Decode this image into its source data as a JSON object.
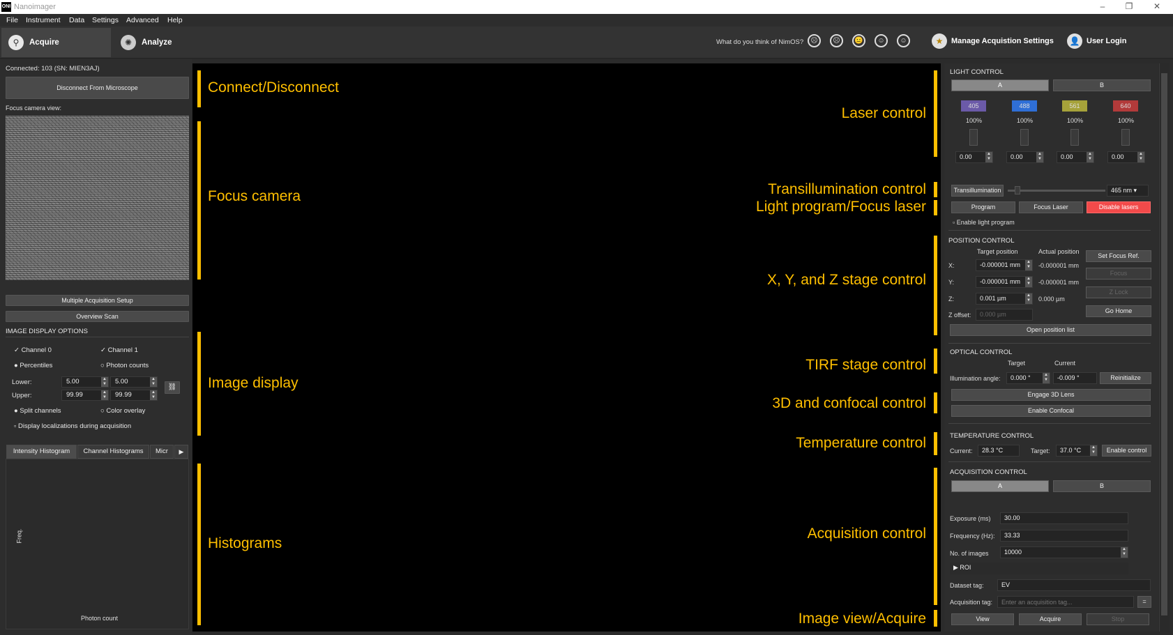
{
  "window": {
    "logo": "ONI",
    "title": "Nanoimager",
    "minimize": "–",
    "restore": "❐",
    "close": "✕"
  },
  "menu": [
    "File",
    "Instrument",
    "Data",
    "Settings",
    "Advanced",
    "Help"
  ],
  "topbar": {
    "acquire_tab": "Acquire",
    "analyze_tab": "Analyze",
    "feedback_prompt": "What do you think of NimOS?",
    "faces": [
      "☹",
      "☹",
      "😐",
      "☺",
      "☺"
    ],
    "manage_settings": "Manage Acquistion Settings",
    "user_login": "User Login"
  },
  "left": {
    "connected": "Connected: 103 (SN: MIEN3AJ)",
    "disconnect_button": "Disconnect From Microscope",
    "focus_camera_label": "Focus camera view:",
    "multi_acq_button": "Multiple Acquisition Setup",
    "overview_scan_button": "Overview Scan",
    "display_options_head": "IMAGE DISPLAY OPTIONS",
    "channel0": "Channel 0",
    "channel1": "Channel 1",
    "percentiles": "Percentiles",
    "photon_counts": "Photon counts",
    "lower_label": "Lower:",
    "upper_label": "Upper:",
    "lower0": "5.00",
    "lower1": "5.00",
    "upper0": "99.99",
    "upper1": "99.99",
    "split_channels": "Split channels",
    "color_overlay": "Color overlay",
    "display_localizations": "Display localizations during acquisition",
    "tabs": [
      "Intensity Histogram",
      "Channel Histograms",
      "Micr"
    ],
    "hist_ylabel": "Freq.",
    "hist_xlabel": "Photon count"
  },
  "annotations_left": [
    "Connect/Disconnect",
    "Focus camera",
    "Image display",
    "Histograms"
  ],
  "annotations_right": [
    "Laser control",
    "Transillumination control",
    "Light program/Focus laser",
    "X, Y, and Z stage control",
    "TIRF stage control",
    "3D and confocal control",
    "Temperature control",
    "Acquisition control",
    "Image view/Acquire"
  ],
  "right": {
    "light_control_head": "LIGHT CONTROL",
    "light_a": "A",
    "light_b": "B",
    "lasers": [
      {
        "wl": "405",
        "pct": "100%",
        "val": "0.00",
        "color": "#6b5aa8"
      },
      {
        "wl": "488",
        "pct": "100%",
        "val": "0.00",
        "color": "#2f6fd6"
      },
      {
        "wl": "561",
        "pct": "100%",
        "val": "0.00",
        "color": "#a6a23a"
      },
      {
        "wl": "640",
        "pct": "100%",
        "val": "0.00",
        "color": "#b23a3a"
      }
    ],
    "transillumination": "Transillumination",
    "trans_wl": "465 nm",
    "program": "Program",
    "focus_laser": "Focus Laser",
    "disable_lasers": "Disable lasers",
    "enable_light_program": "Enable light program",
    "position_head": "POSITION CONTROL",
    "target_position": "Target position",
    "actual_position": "Actual position",
    "set_focus_ref": "Set Focus Ref.",
    "x_label": "X:",
    "y_label": "Y:",
    "z_label": "Z:",
    "zoffset_label": "Z offset:",
    "x_target": "-0.000001 mm",
    "x_actual": "-0.000001 mm",
    "y_target": "-0.000001 mm",
    "y_actual": "-0.000001 mm",
    "z_target": "0.001 µm",
    "z_actual": "0.000 µm",
    "zoffset": "0.000 µm",
    "focus": "Focus",
    "z_lock": "Z Lock",
    "go_home": "Go Home",
    "open_position_list": "Open position list",
    "optical_head": "OPTICAL CONTROL",
    "target": "Target",
    "current": "Current",
    "illum_label": "Illumination angle:",
    "illum_target": "0.000 °",
    "illum_current": "-0.009 °",
    "reinitialize": "Reinitialize",
    "engage_3d": "Engage 3D Lens",
    "enable_confocal": "Enable Confocal",
    "temp_head": "TEMPERATURE CONTROL",
    "temp_current_label": "Current:",
    "temp_current": "28.3 °C",
    "temp_target_label": "Target:",
    "temp_target": "37.0 °C",
    "enable_control": "Enable control",
    "acq_head": "ACQUISITION CONTROL",
    "acq_a": "A",
    "acq_b": "B",
    "exposure_label": "Exposure (ms)",
    "exposure": "30.00",
    "frequency_label": "Frequency (Hz):",
    "frequency": "33.33",
    "nimages_label": "No. of images",
    "nimages": "10000",
    "roi": "▶  ROI",
    "dataset_tag_label": "Dataset tag:",
    "dataset_tag": "EV",
    "acq_tag_label": "Acquisition tag:",
    "acq_tag_placeholder": "Enter an acquisition tag...",
    "view": "View",
    "acquire": "Acquire",
    "stop": "Stop"
  }
}
